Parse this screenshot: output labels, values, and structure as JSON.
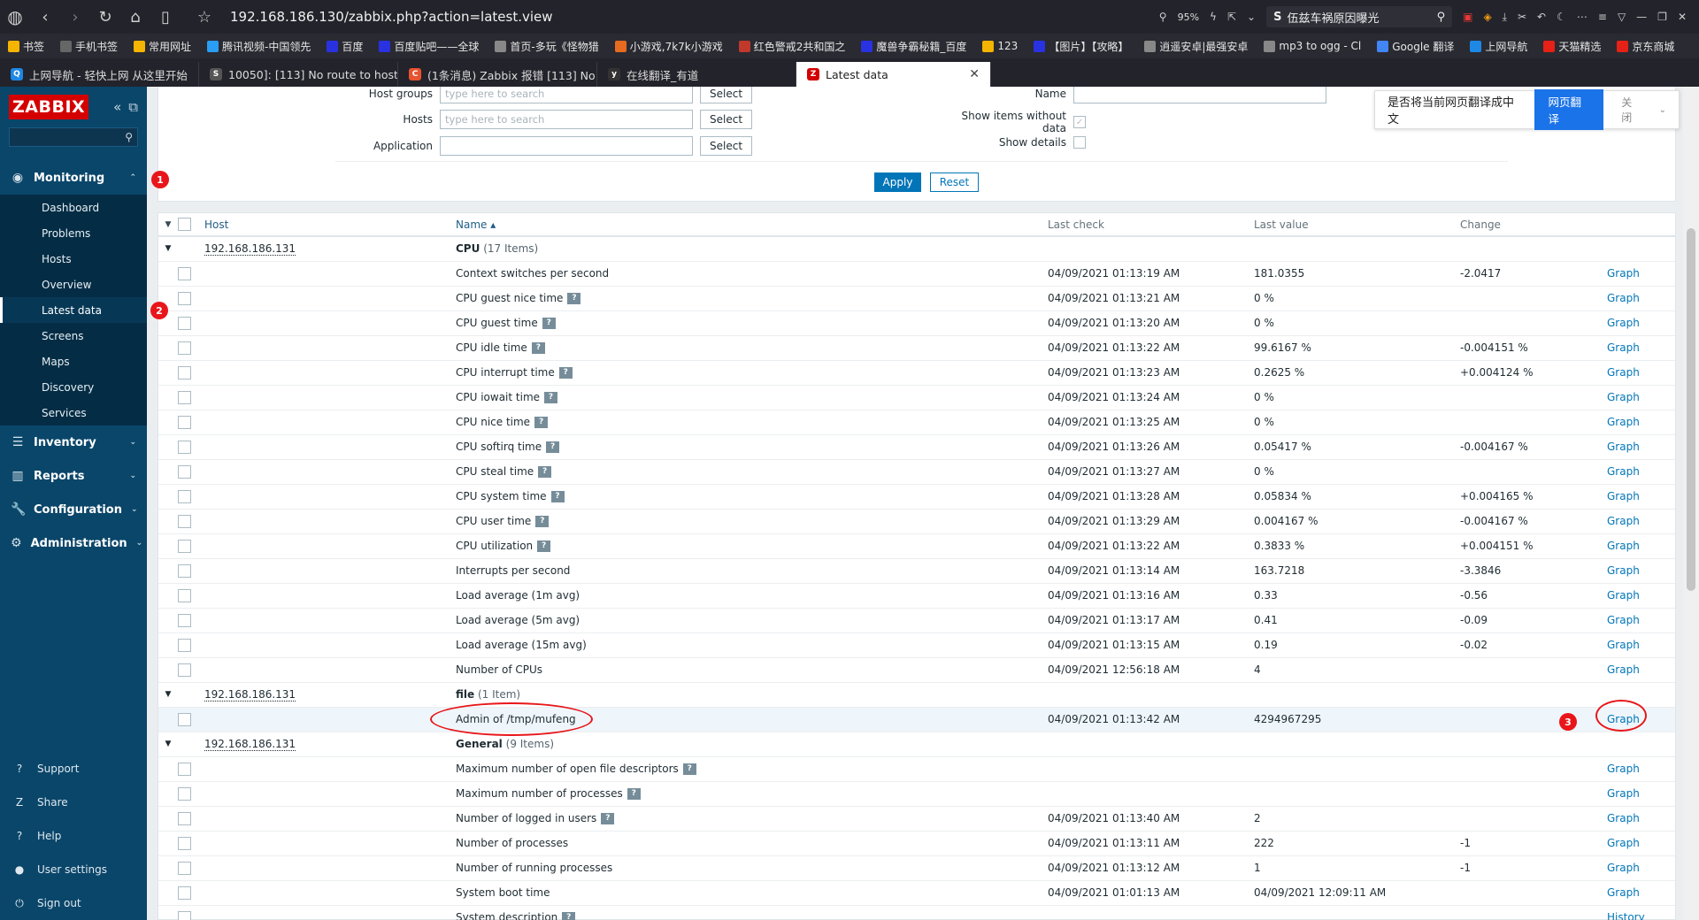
{
  "browser": {
    "url": "192.168.186.130/zabbix.php?action=latest.view",
    "zoom": "95%",
    "search_text": "伍兹车祸原因曝光",
    "bookmarks": [
      {
        "label": "书签",
        "color": "#f4b400"
      },
      {
        "label": "手机书签",
        "color": "#666"
      },
      {
        "label": "常用网址",
        "color": "#f4b400"
      },
      {
        "label": "腾讯视频-中国领先",
        "color": "#2a9df4"
      },
      {
        "label": "百度",
        "color": "#2932e1"
      },
      {
        "label": "百度贴吧——全球",
        "color": "#2932e1"
      },
      {
        "label": "首页-多玩《怪物猎",
        "color": "#888"
      },
      {
        "label": "小游戏,7k7k小游戏",
        "color": "#e46b1f"
      },
      {
        "label": "红色警戒2共和国之",
        "color": "#c0392b"
      },
      {
        "label": "魔兽争霸秘籍_百度",
        "color": "#2932e1"
      },
      {
        "label": "123",
        "color": "#f4b400"
      },
      {
        "label": "【图片】【攻略】",
        "color": "#2932e1"
      },
      {
        "label": "逍遥安卓|最强安卓",
        "color": "#888"
      },
      {
        "label": "mp3 to ogg - Cl",
        "color": "#888"
      },
      {
        "label": "Google 翻译",
        "color": "#4285f4"
      },
      {
        "label": "上网导航",
        "color": "#1e88e5"
      },
      {
        "label": "天猫精选",
        "color": "#e62117"
      },
      {
        "label": "京东商城",
        "color": "#e62117"
      }
    ],
    "tabs": [
      {
        "label": "上网导航 - 轻快上网 从这里开始",
        "fav": "Q",
        "color": "#1e88e5"
      },
      {
        "label": "10050]: [113] No route to host",
        "fav": "S",
        "color": "#555"
      },
      {
        "label": "(1条消息) Zabbix 报错 [113] No",
        "fav": "C",
        "color": "#e8542f"
      },
      {
        "label": "在线翻译_有道",
        "fav": "y",
        "color": "#333"
      },
      {
        "label": "Latest data",
        "fav": "Z",
        "color": "#d40000",
        "active": true
      }
    ]
  },
  "sidebar": {
    "logo": "ZABBIX",
    "menu": [
      {
        "label": "Monitoring",
        "icon": "eye-icon",
        "glyph": "◉",
        "open": true
      },
      {
        "label": "Inventory",
        "icon": "list-icon",
        "glyph": "☰"
      },
      {
        "label": "Reports",
        "icon": "chart-icon",
        "glyph": "▥"
      },
      {
        "label": "Configuration",
        "icon": "wrench-icon",
        "glyph": "🔧"
      },
      {
        "label": "Administration",
        "icon": "gear-icon",
        "glyph": "⚙"
      }
    ],
    "monitoring_sub": [
      "Dashboard",
      "Problems",
      "Hosts",
      "Overview",
      "Latest data",
      "Screens",
      "Maps",
      "Discovery",
      "Services"
    ],
    "active_sub": "Latest data",
    "bottom": [
      {
        "label": "Support",
        "glyph": "?"
      },
      {
        "label": "Share",
        "glyph": "Z"
      },
      {
        "label": "Help",
        "glyph": "?"
      },
      {
        "label": "User settings",
        "glyph": "●"
      },
      {
        "label": "Sign out",
        "glyph": "⏻"
      }
    ]
  },
  "filter": {
    "host_groups_label": "Host groups",
    "hosts_label": "Hosts",
    "application_label": "Application",
    "placeholder": "type here to search",
    "select_label": "Select",
    "name_label": "Name",
    "show_items_label": "Show items without data",
    "show_details_label": "Show details",
    "apply_label": "Apply",
    "reset_label": "Reset"
  },
  "translate_popup": {
    "question": "是否将当前网页翻译成中文",
    "button": "网页翻译",
    "close": "关闭"
  },
  "table": {
    "headers": {
      "host": "Host",
      "name": "Name ▴",
      "last_check": "Last check",
      "last_value": "Last value",
      "change": "Change"
    },
    "graph_label": "Graph",
    "history_label": "History",
    "groups": [
      {
        "host": "192.168.186.131",
        "name": "CPU",
        "count": "(17 Items)",
        "items": [
          {
            "name": "Context switches per second",
            "hint": false,
            "last_check": "04/09/2021 01:13:19 AM",
            "last_value": "181.0355",
            "change": "-2.0417",
            "action": "Graph"
          },
          {
            "name": "CPU guest nice time",
            "hint": true,
            "last_check": "04/09/2021 01:13:21 AM",
            "last_value": "0 %",
            "change": "",
            "action": "Graph"
          },
          {
            "name": "CPU guest time",
            "hint": true,
            "last_check": "04/09/2021 01:13:20 AM",
            "last_value": "0 %",
            "change": "",
            "action": "Graph"
          },
          {
            "name": "CPU idle time",
            "hint": true,
            "last_check": "04/09/2021 01:13:22 AM",
            "last_value": "99.6167 %",
            "change": "-0.004151 %",
            "action": "Graph"
          },
          {
            "name": "CPU interrupt time",
            "hint": true,
            "last_check": "04/09/2021 01:13:23 AM",
            "last_value": "0.2625 %",
            "change": "+0.004124 %",
            "action": "Graph"
          },
          {
            "name": "CPU iowait time",
            "hint": true,
            "last_check": "04/09/2021 01:13:24 AM",
            "last_value": "0 %",
            "change": "",
            "action": "Graph"
          },
          {
            "name": "CPU nice time",
            "hint": true,
            "last_check": "04/09/2021 01:13:25 AM",
            "last_value": "0 %",
            "change": "",
            "action": "Graph"
          },
          {
            "name": "CPU softirq time",
            "hint": true,
            "last_check": "04/09/2021 01:13:26 AM",
            "last_value": "0.05417 %",
            "change": "-0.004167 %",
            "action": "Graph"
          },
          {
            "name": "CPU steal time",
            "hint": true,
            "last_check": "04/09/2021 01:13:27 AM",
            "last_value": "0 %",
            "change": "",
            "action": "Graph"
          },
          {
            "name": "CPU system time",
            "hint": true,
            "last_check": "04/09/2021 01:13:28 AM",
            "last_value": "0.05834 %",
            "change": "+0.004165 %",
            "action": "Graph"
          },
          {
            "name": "CPU user time",
            "hint": true,
            "last_check": "04/09/2021 01:13:29 AM",
            "last_value": "0.004167 %",
            "change": "-0.004167 %",
            "action": "Graph"
          },
          {
            "name": "CPU utilization",
            "hint": true,
            "last_check": "04/09/2021 01:13:22 AM",
            "last_value": "0.3833 %",
            "change": "+0.004151 %",
            "action": "Graph"
          },
          {
            "name": "Interrupts per second",
            "hint": false,
            "last_check": "04/09/2021 01:13:14 AM",
            "last_value": "163.7218",
            "change": "-3.3846",
            "action": "Graph"
          },
          {
            "name": "Load average (1m avg)",
            "hint": false,
            "last_check": "04/09/2021 01:13:16 AM",
            "last_value": "0.33",
            "change": "-0.56",
            "action": "Graph"
          },
          {
            "name": "Load average (5m avg)",
            "hint": false,
            "last_check": "04/09/2021 01:13:17 AM",
            "last_value": "0.41",
            "change": "-0.09",
            "action": "Graph"
          },
          {
            "name": "Load average (15m avg)",
            "hint": false,
            "last_check": "04/09/2021 01:13:15 AM",
            "last_value": "0.19",
            "change": "-0.02",
            "action": "Graph"
          },
          {
            "name": "Number of CPUs",
            "hint": false,
            "last_check": "04/09/2021 12:56:18 AM",
            "last_value": "4",
            "change": "",
            "action": "Graph"
          }
        ]
      },
      {
        "host": "192.168.186.131",
        "name": "file",
        "count": "(1 Item)",
        "items": [
          {
            "name": "Admin of /tmp/mufeng",
            "hint": false,
            "last_check": "04/09/2021 01:13:42 AM",
            "last_value": "4294967295",
            "change": "",
            "action": "Graph",
            "highlight": true
          }
        ]
      },
      {
        "host": "192.168.186.131",
        "name": "General",
        "count": "(9 Items)",
        "items": [
          {
            "name": "Maximum number of open file descriptors",
            "hint": true,
            "last_check": "",
            "last_value": "",
            "change": "",
            "action": "Graph"
          },
          {
            "name": "Maximum number of processes",
            "hint": true,
            "last_check": "",
            "last_value": "",
            "change": "",
            "action": "Graph"
          },
          {
            "name": "Number of logged in users",
            "hint": true,
            "last_check": "04/09/2021 01:13:40 AM",
            "last_value": "2",
            "change": "",
            "action": "Graph"
          },
          {
            "name": "Number of processes",
            "hint": false,
            "last_check": "04/09/2021 01:13:11 AM",
            "last_value": "222",
            "change": "-1",
            "action": "Graph"
          },
          {
            "name": "Number of running processes",
            "hint": false,
            "last_check": "04/09/2021 01:13:12 AM",
            "last_value": "1",
            "change": "-1",
            "action": "Graph"
          },
          {
            "name": "System boot time",
            "hint": false,
            "last_check": "04/09/2021 01:01:13 AM",
            "last_value": "04/09/2021 12:09:11 AM",
            "change": "",
            "action": "Graph"
          },
          {
            "name": "System description",
            "hint": true,
            "last_check": "",
            "last_value": "",
            "change": "",
            "action": "History"
          }
        ]
      }
    ]
  },
  "annotations": [
    "1",
    "2",
    "3"
  ],
  "colors": {
    "sidebar": "#0a466a",
    "accent": "#0275b8",
    "logo": "#d40000",
    "annotation": "#e8161a"
  }
}
